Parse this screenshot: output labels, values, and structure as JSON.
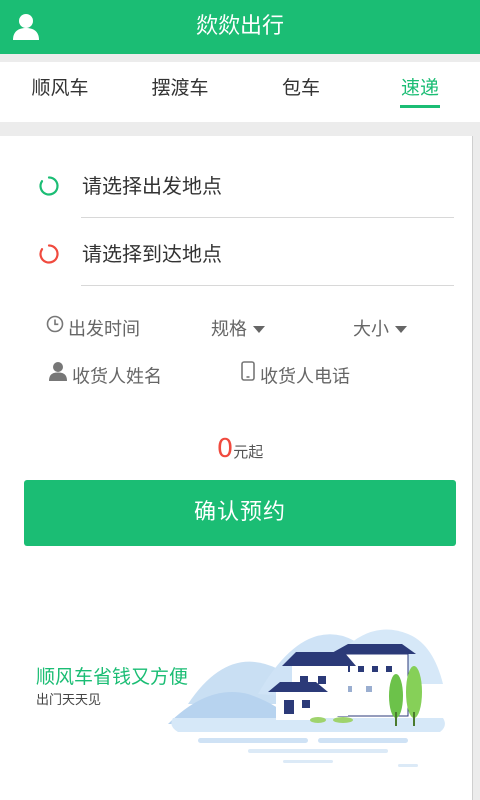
{
  "header": {
    "title": "欻欻出行"
  },
  "tabs": [
    {
      "label": "顺风车"
    },
    {
      "label": "摆渡车"
    },
    {
      "label": "包车"
    },
    {
      "label": "速递"
    }
  ],
  "locations": {
    "departure_placeholder": "请选择出发地点",
    "arrival_placeholder": "请选择到达地点"
  },
  "options": {
    "departure_time": "出发时间",
    "spec": "规格",
    "size": "大小",
    "receiver_name": "收货人姓名",
    "receiver_phone": "收货人电话"
  },
  "price": {
    "amount": "0",
    "unit": "元起"
  },
  "confirm_button": "确认预约",
  "promo": {
    "slogan": "顺风车省钱又方便",
    "subtitle": "出门天天见"
  },
  "colors": {
    "brand_green": "#1bbd74",
    "arrival_red": "#f04a3e"
  }
}
